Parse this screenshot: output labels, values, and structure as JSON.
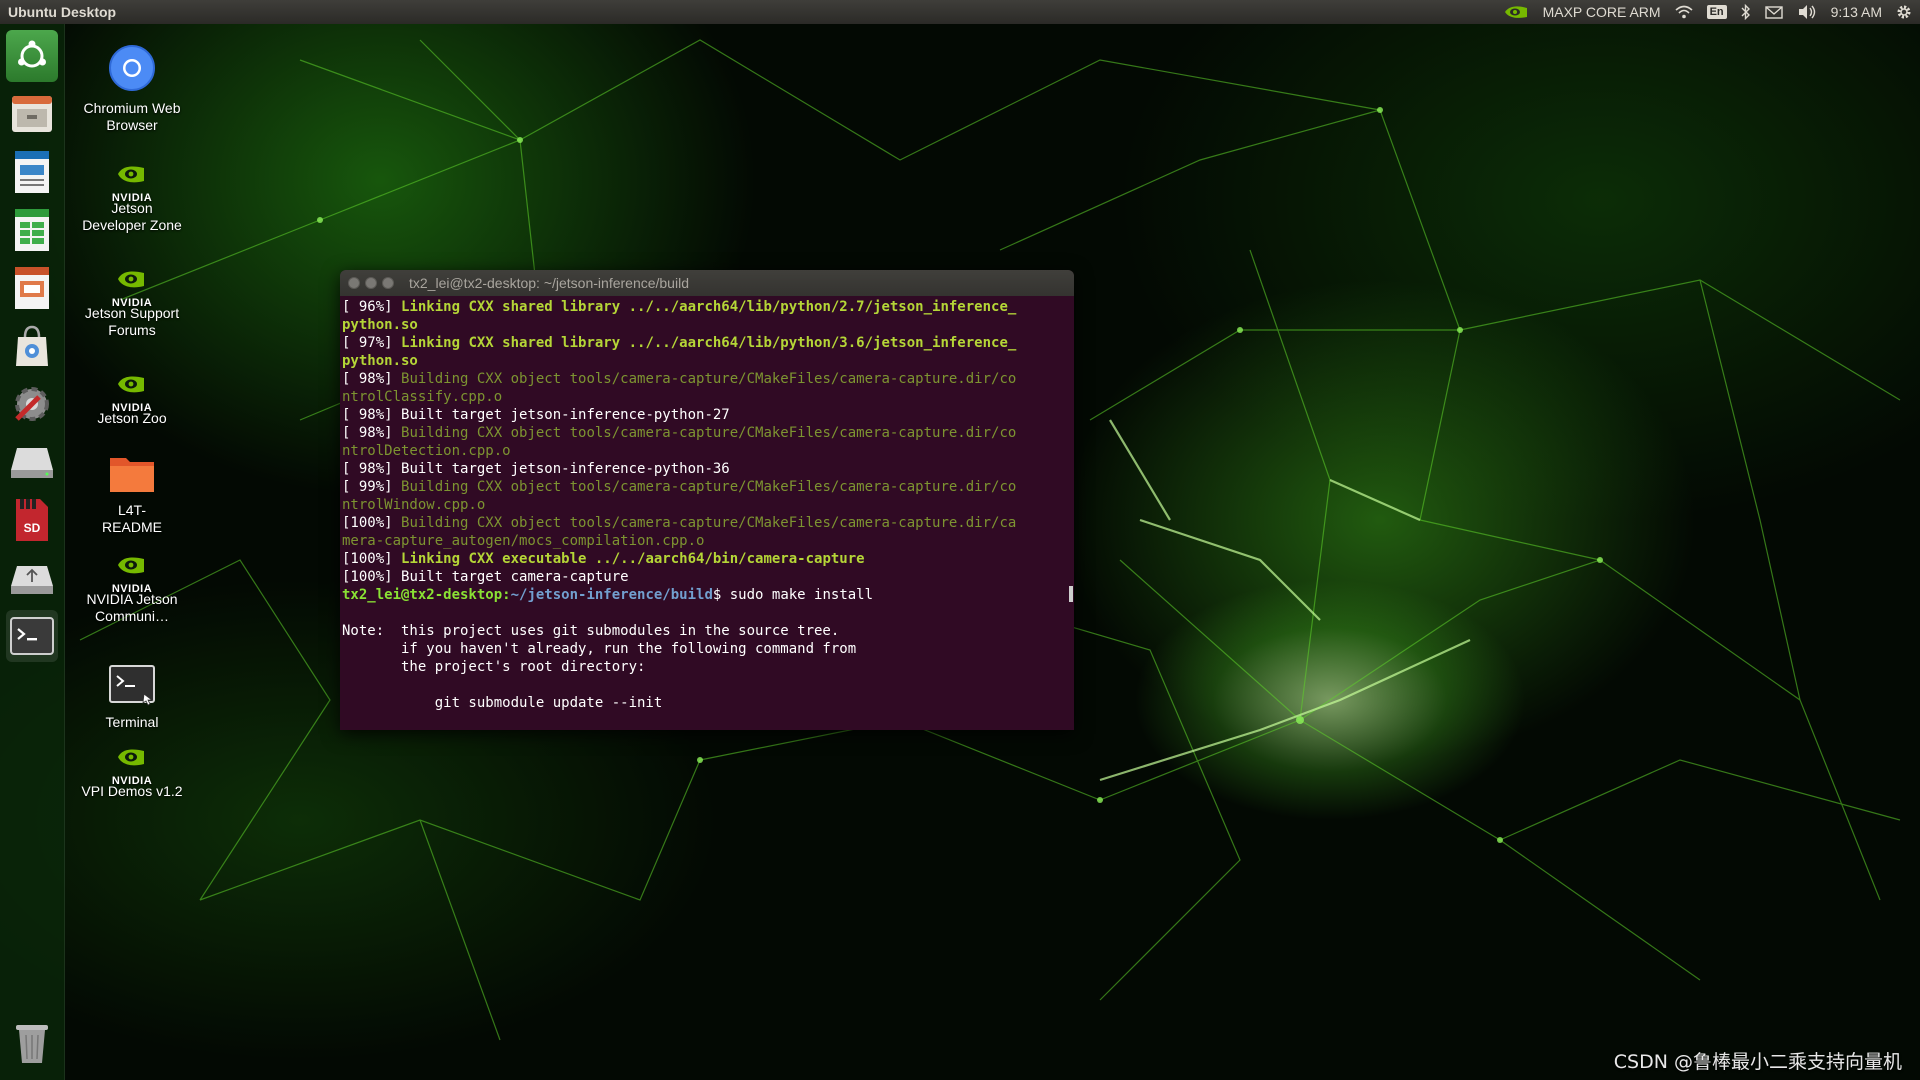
{
  "top_panel": {
    "title": "Ubuntu Desktop",
    "power_mode": "MAXP CORE ARM",
    "keyboard": "En",
    "clock": "9:13 AM",
    "icons": [
      "nvidia-icon",
      "wifi-icon",
      "bluetooth-icon",
      "mail-icon",
      "volume-icon",
      "gear-icon"
    ]
  },
  "launcher": {
    "items": [
      {
        "name": "launcher-ubuntu-dash",
        "icon": "ubuntu-icon"
      },
      {
        "name": "launcher-files",
        "icon": "files-icon"
      },
      {
        "name": "launcher-writer",
        "icon": "document-icon"
      },
      {
        "name": "launcher-calc",
        "icon": "spreadsheet-icon"
      },
      {
        "name": "launcher-impress",
        "icon": "presentation-icon"
      },
      {
        "name": "launcher-software",
        "icon": "shopping-bag-icon"
      },
      {
        "name": "launcher-settings",
        "icon": "wrench-icon"
      },
      {
        "name": "launcher-drive",
        "icon": "drive-icon"
      },
      {
        "name": "launcher-sd-card",
        "icon": "sd-card-icon"
      },
      {
        "name": "launcher-usb",
        "icon": "usb-drive-icon"
      },
      {
        "name": "launcher-terminal",
        "icon": "terminal-icon"
      },
      {
        "name": "launcher-trash",
        "icon": "trash-icon"
      }
    ],
    "sd_label": "SD"
  },
  "desktop_icons": [
    {
      "label": "Chromium Web Browser",
      "icon": "chromium-icon"
    },
    {
      "label": "Jetson Developer Zone",
      "icon": "nvidia-icon",
      "brand": "NVIDIA"
    },
    {
      "label": "Jetson Support Forums",
      "icon": "nvidia-icon",
      "brand": "NVIDIA"
    },
    {
      "label": "Jetson Zoo",
      "icon": "nvidia-icon",
      "brand": "NVIDIA"
    },
    {
      "label": "L4T-README",
      "icon": "folder-icon"
    },
    {
      "label": "NVIDIA Jetson Communi…",
      "icon": "nvidia-icon",
      "brand": "NVIDIA"
    },
    {
      "label": "Terminal",
      "icon": "terminal-icon"
    },
    {
      "label": "VPI Demos v1.2",
      "icon": "nvidia-icon",
      "brand": "NVIDIA"
    }
  ],
  "terminal": {
    "title": "tx2_lei@tx2-desktop: ~/jetson-inference/build",
    "lines": [
      {
        "style": "bold",
        "prefix": "[ 96%] ",
        "text": "Linking CXX shared library ../../aarch64/lib/python/2.7/jetson_inference_"
      },
      {
        "style": "bold",
        "prefix": "",
        "text": "python.so"
      },
      {
        "style": "bold",
        "prefix": "[ 97%] ",
        "text": "Linking CXX shared library ../../aarch64/lib/python/3.6/jetson_inference_"
      },
      {
        "style": "bold",
        "prefix": "",
        "text": "python.so"
      },
      {
        "style": "dim",
        "prefix": "[ 98%] ",
        "text": "Building CXX object tools/camera-capture/CMakeFiles/camera-capture.dir/co"
      },
      {
        "style": "dim",
        "prefix": "",
        "text": "ntrolClassify.cpp.o"
      },
      {
        "style": "white",
        "prefix": "[ 98%] ",
        "text": "Built target jetson-inference-python-27"
      },
      {
        "style": "dim",
        "prefix": "[ 98%] ",
        "text": "Building CXX object tools/camera-capture/CMakeFiles/camera-capture.dir/co"
      },
      {
        "style": "dim",
        "prefix": "",
        "text": "ntrolDetection.cpp.o"
      },
      {
        "style": "white",
        "prefix": "[ 98%] ",
        "text": "Built target jetson-inference-python-36"
      },
      {
        "style": "dim",
        "prefix": "[ 99%] ",
        "text": "Building CXX object tools/camera-capture/CMakeFiles/camera-capture.dir/co"
      },
      {
        "style": "dim",
        "prefix": "",
        "text": "ntrolWindow.cpp.o"
      },
      {
        "style": "dim",
        "prefix": "[100%] ",
        "text": "Building CXX object tools/camera-capture/CMakeFiles/camera-capture.dir/ca"
      },
      {
        "style": "dim",
        "prefix": "",
        "text": "mera-capture_autogen/mocs_compilation.cpp.o"
      },
      {
        "style": "bold",
        "prefix": "[100%] ",
        "text": "Linking CXX executable ../../aarch64/bin/camera-capture"
      },
      {
        "style": "white",
        "prefix": "[100%] ",
        "text": "Built target camera-capture"
      },
      {
        "style": "prompt",
        "user": "tx2_lei@tx2-desktop",
        "path": "~/jetson-inference/build",
        "text": "$ sudo make install"
      },
      {
        "style": "white",
        "prefix": "",
        "text": ""
      },
      {
        "style": "white",
        "prefix": "",
        "text": "Note:  this project uses git submodules in the source tree."
      },
      {
        "style": "white",
        "prefix": "",
        "text": "       if you haven't already, run the following command from"
      },
      {
        "style": "white",
        "prefix": "",
        "text": "       the project's root directory:"
      },
      {
        "style": "white",
        "prefix": "",
        "text": ""
      },
      {
        "style": "white",
        "prefix": "",
        "text": "           git submodule update --init"
      }
    ]
  },
  "watermark": "CSDN @鲁棒最小二乘支持向量机",
  "colors": {
    "panel": "#3c3b37",
    "terminal_bg": "#300a24",
    "bold_green": "#b5d637",
    "dim_green": "#7d9431",
    "prompt_user": "#8ae234",
    "prompt_path": "#729fcf",
    "nvidia_green": "#76b900"
  }
}
